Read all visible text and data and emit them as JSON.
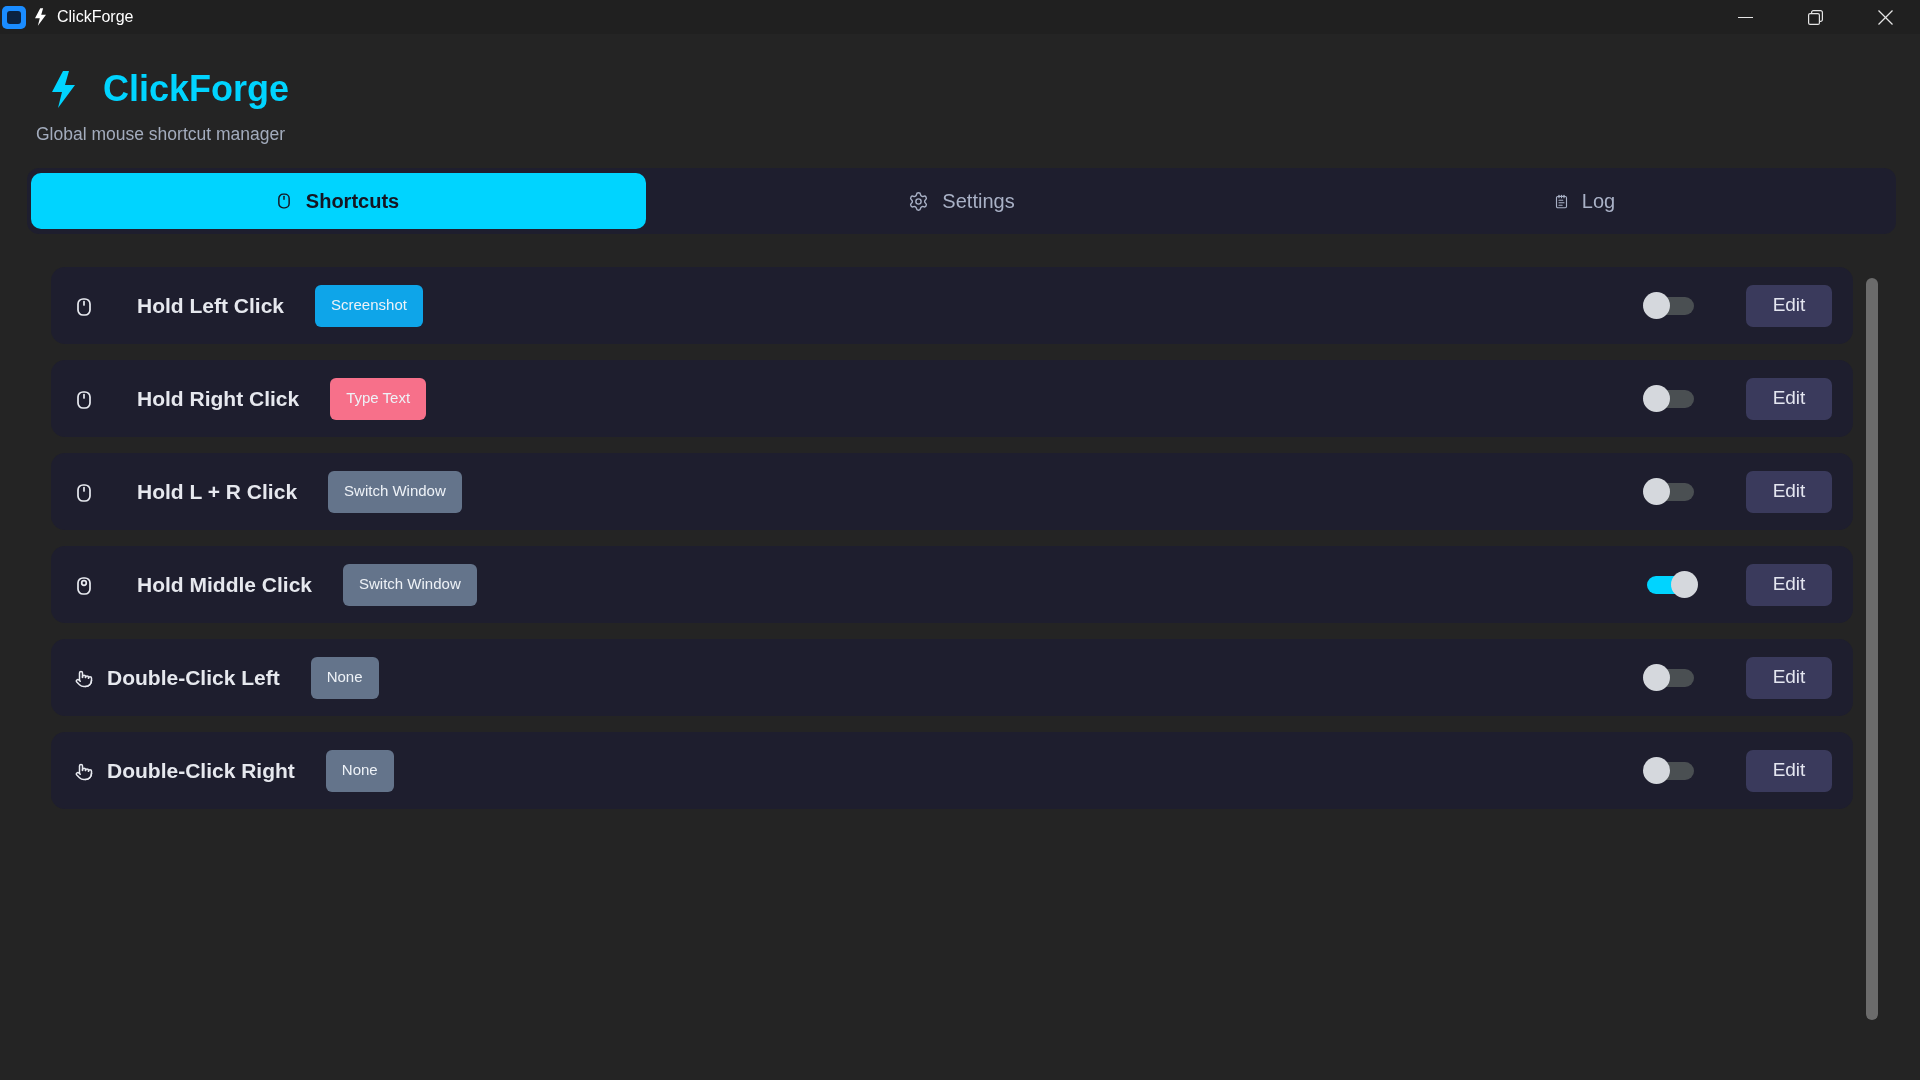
{
  "window": {
    "title": "ClickForge"
  },
  "header": {
    "title": "ClickForge",
    "subtitle": "Global mouse shortcut manager"
  },
  "tabs": [
    {
      "label": "Shortcuts",
      "selected": true
    },
    {
      "label": "Settings",
      "selected": false
    },
    {
      "label": "Log",
      "selected": false
    }
  ],
  "shortcuts": [
    {
      "kind": "hold",
      "name": "Hold Left Click",
      "action": {
        "label": "Screenshot",
        "color": "#0ea5e9"
      },
      "on": false,
      "edit": "Edit"
    },
    {
      "kind": "hold",
      "name": "Hold Right Click",
      "action": {
        "label": "Type Text",
        "color": "#f7708a"
      },
      "on": false,
      "edit": "Edit"
    },
    {
      "kind": "hold",
      "name": "Hold L + R Click",
      "action": {
        "label": "Switch Window",
        "color": "#64748b"
      },
      "on": false,
      "edit": "Edit"
    },
    {
      "kind": "hold-middle",
      "name": "Hold Middle Click",
      "action": {
        "label": "Switch Window",
        "color": "#64748b"
      },
      "on": true,
      "edit": "Edit"
    },
    {
      "kind": "double-click",
      "name": "Double-Click Left",
      "action": {
        "label": "None",
        "color": "#64748b"
      },
      "on": false,
      "edit": "Edit"
    },
    {
      "kind": "double-click",
      "name": "Double-Click Right",
      "action": {
        "label": "None",
        "color": "#64748b"
      },
      "on": false,
      "edit": "Edit"
    }
  ]
}
